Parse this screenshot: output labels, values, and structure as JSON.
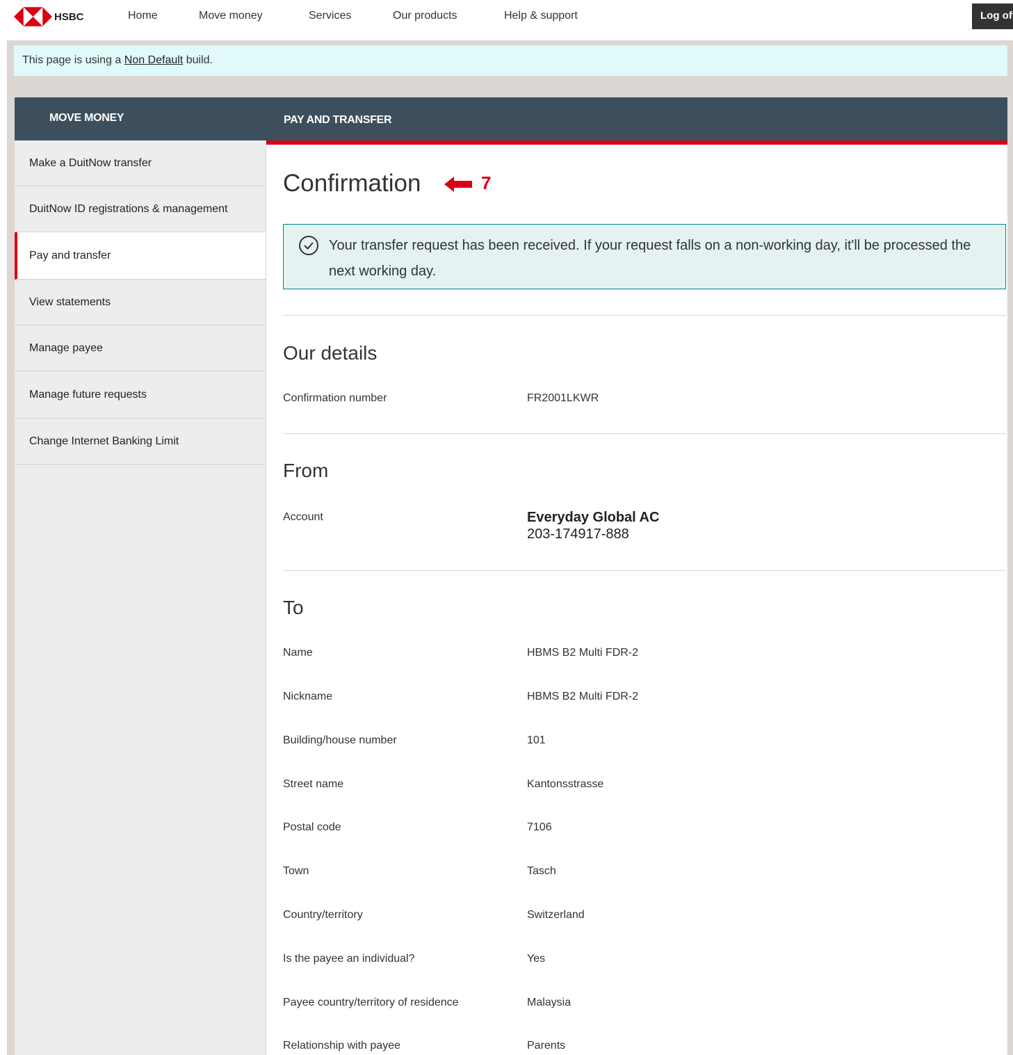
{
  "brand": {
    "name": "HSBC",
    "primary_red": "#db0011",
    "header_bg": "#3d4f5d",
    "success_border": "#00847f"
  },
  "topnav": {
    "items": [
      "Home",
      "Move money",
      "Services",
      "Our products",
      "Help & support"
    ],
    "logoff_label": "Log off"
  },
  "banner": {
    "prefix": "This page is using a ",
    "link": "Non Default",
    "suffix": " build."
  },
  "header": {
    "sidebar_title": "MOVE MONEY",
    "content_title": "PAY AND TRANSFER"
  },
  "sidebar": {
    "items": [
      "Make a DuitNow transfer",
      "DuitNow ID registrations & management",
      "Pay and transfer",
      "View statements",
      "Manage payee",
      "Manage future requests",
      "Change Internet Banking Limit"
    ],
    "active_index": 2
  },
  "main": {
    "title": "Confirmation",
    "annotation_number": "7",
    "success_message": "Your transfer request has been received. If your request falls on a non-working day, it'll be processed the next working day.",
    "our_details": {
      "title": "Our details",
      "confirmation_label": "Confirmation number",
      "confirmation_value": "FR2001LKWR"
    },
    "from": {
      "title": "From",
      "account_label": "Account",
      "account_name": "Everyday Global AC",
      "account_number": "203-174917-888"
    },
    "to": {
      "title": "To",
      "rows": [
        {
          "label": "Name",
          "value": "HBMS B2 Multi FDR-2"
        },
        {
          "label": "Nickname",
          "value": "HBMS B2 Multi FDR-2"
        },
        {
          "label": "Building/house number",
          "value": "101"
        },
        {
          "label": "Street name",
          "value": "Kantonsstrasse"
        },
        {
          "label": "Postal code",
          "value": "7106"
        },
        {
          "label": "Town",
          "value": "Tasch"
        },
        {
          "label": "Country/territory",
          "value": "Switzerland"
        },
        {
          "label": "Is the payee an individual?",
          "value": "Yes"
        },
        {
          "label": "Payee country/territory of residence",
          "value": "Malaysia"
        },
        {
          "label": "Relationship with payee",
          "value": "Parents"
        }
      ]
    }
  }
}
